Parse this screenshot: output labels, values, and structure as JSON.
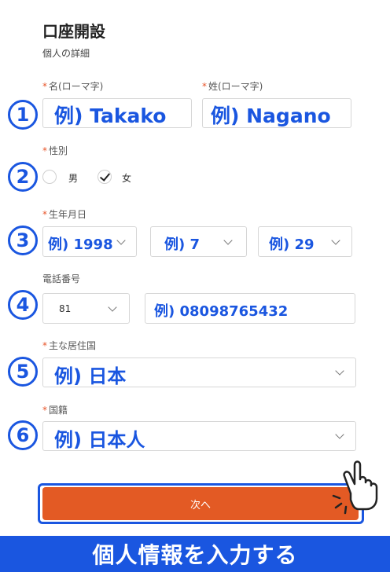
{
  "header": {
    "title": "口座開設",
    "subtitle": "個人の詳細"
  },
  "steps": [
    "1",
    "2",
    "3",
    "4",
    "5",
    "6"
  ],
  "name": {
    "first_label": "名(ローマ字)",
    "first_placeholder": "例) Takako",
    "last_label": "姓(ローマ字)",
    "last_placeholder": "例) Nagano"
  },
  "gender": {
    "label": "性別",
    "options": [
      {
        "label": "男",
        "selected": false
      },
      {
        "label": "女",
        "selected": true
      }
    ]
  },
  "birthdate": {
    "label": "生年月日",
    "year": "例) 1998",
    "month": "例) 7",
    "day": "例) 29"
  },
  "phone": {
    "label": "電話番号",
    "country_code": "81",
    "number_placeholder": "例) 08098765432"
  },
  "residence": {
    "label": "主な居住国",
    "value": "例) 日本"
  },
  "nationality": {
    "label": "国籍",
    "value": "例) 日本人"
  },
  "required_mark": "*",
  "next_button": "次へ",
  "banner": "個人情報を入力する",
  "colors": {
    "accent": "#1a56e0",
    "button": "#e35a24",
    "required": "#e8552a"
  },
  "icons": [
    "chevron-down-icon",
    "check-icon",
    "pointing-hand-icon"
  ]
}
